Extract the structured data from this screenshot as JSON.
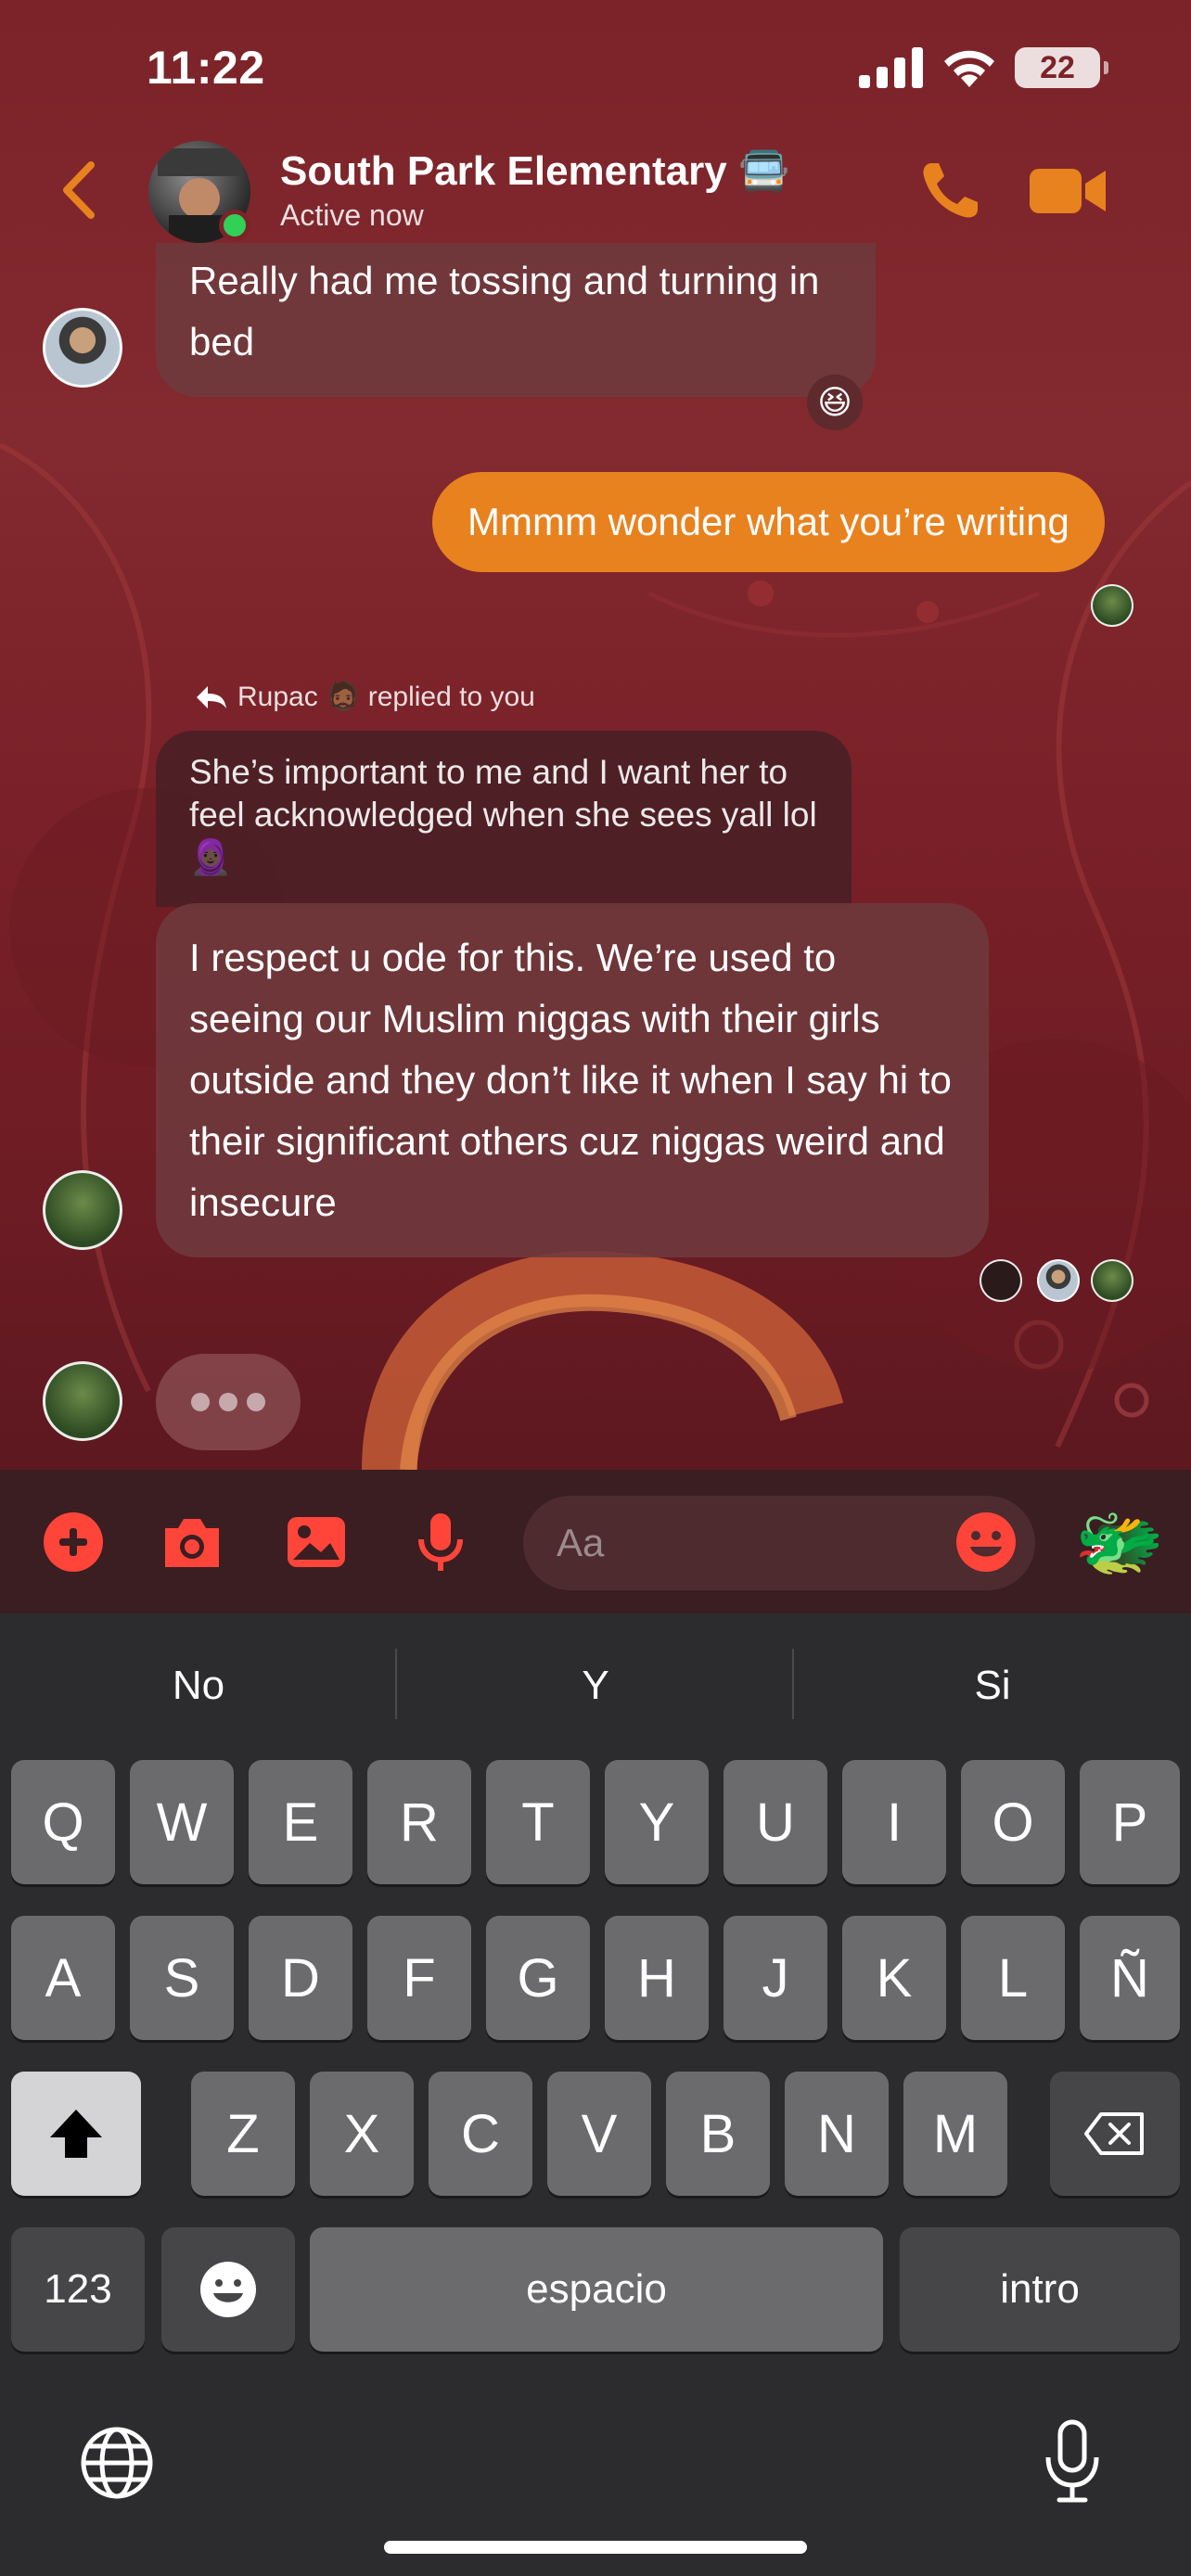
{
  "status_bar": {
    "time": "11:22",
    "battery": "22"
  },
  "header": {
    "title": "South Park Elementary 🚍",
    "subtitle": "Active now"
  },
  "messages": {
    "m1": "Really had me tossing and turning in bed",
    "m1_reaction": "😆",
    "m2": "Mmmm wonder what you’re writing",
    "reply_label": "Rupac 🧔🏾 replied to you",
    "quoted": "She’s important to me and I want her to feel acknowledged when she sees yall lol 🧕🏿",
    "m3": "I respect u ode for this. We’re used to seeing our Muslim niggas with their girls outside and they don’t like it when I say hi to their significant others cuz niggas weird and insecure"
  },
  "composer": {
    "placeholder": "Aa",
    "quick_emoji": "🐲"
  },
  "keyboard": {
    "suggestions": [
      "No",
      "Y",
      "Si"
    ],
    "row1": [
      "Q",
      "W",
      "E",
      "R",
      "T",
      "Y",
      "U",
      "I",
      "O",
      "P"
    ],
    "row2": [
      "A",
      "S",
      "D",
      "F",
      "G",
      "H",
      "J",
      "K",
      "L",
      "Ñ"
    ],
    "row3": [
      "Z",
      "X",
      "C",
      "V",
      "B",
      "N",
      "M"
    ],
    "numbers_label": "123",
    "space_label": "espacio",
    "return_label": "intro"
  },
  "colors": {
    "accent": "#e8821f",
    "chat_bg": "#7c2329",
    "keyboard_bg": "#2c2c2e",
    "online": "#31d158"
  }
}
